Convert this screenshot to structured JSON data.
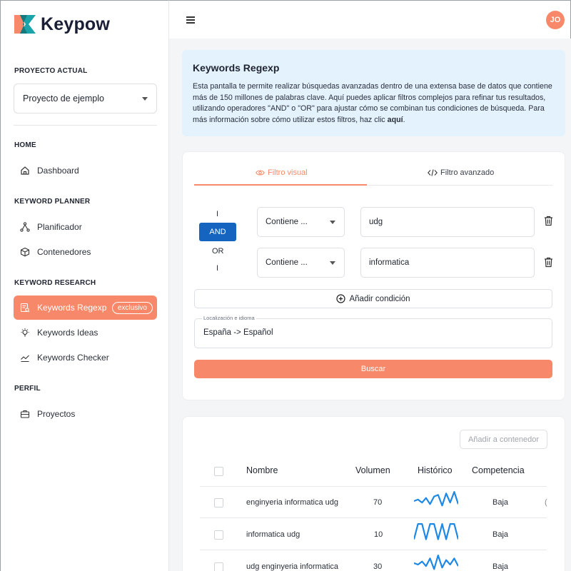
{
  "brand": {
    "name": "Keypow",
    "accent": "#f7896a",
    "accent_dark": "#14a0a6"
  },
  "sidebar": {
    "project_label": "PROYECTO ACTUAL",
    "project_value": "Proyecto de ejemplo",
    "sections": {
      "home": "HOME",
      "planner": "KEYWORD PLANNER",
      "research": "KEYWORD RESEARCH",
      "profile": "PERFIL"
    },
    "items": {
      "dashboard": {
        "label": "Dashboard",
        "icon": "home-icon"
      },
      "planificador": {
        "label": "Planificador",
        "icon": "branch-icon"
      },
      "contenedores": {
        "label": "Contenedores",
        "icon": "box-icon"
      },
      "regexp": {
        "label": "Keywords Regexp",
        "icon": "regexp-icon",
        "badge": "exclusivo"
      },
      "ideas": {
        "label": "Keywords Ideas",
        "icon": "bulb-icon"
      },
      "checker": {
        "label": "Keywords Checker",
        "icon": "chart-icon"
      },
      "proyectos": {
        "label": "Proyectos",
        "icon": "briefcase-icon"
      }
    }
  },
  "topbar": {
    "avatar_initials": "JO"
  },
  "info": {
    "title": "Keywords Regexp",
    "text": "Esta pantalla te permite realizar búsquedas avanzadas dentro de una extensa base de datos que contiene más de 150 millones de palabras clave. Aquí puedes aplicar filtros complejos para refinar tus resultados, utilizando operadores \"AND\" o \"OR\" para ajustar cómo se combinan tus condiciones de búsqueda. Para más información sobre cómo utilizar estos filtros, haz clic ",
    "link": "aquí",
    "end": "."
  },
  "filter": {
    "tab_visual": "Filtro visual",
    "tab_advanced": "Filtro avanzado",
    "op_and": "AND",
    "op_or": "OR",
    "bar": "I",
    "conditions": [
      {
        "operator": "Contiene ...",
        "value": "udg"
      },
      {
        "operator": "Contiene ...",
        "value": "informatica"
      }
    ],
    "add_condition": "Añadir condición",
    "location_label": "Localización e idioma",
    "location_value": "España -> Español",
    "search_button": "Buscar"
  },
  "results": {
    "add_to_container": "Añadir a contenedor",
    "columns": {
      "name": "Nombre",
      "volume": "Volumen",
      "history": "Histórico",
      "competition": "Competencia"
    },
    "rows": [
      {
        "name": "enginyeria informatica udg",
        "volume": "70",
        "history": [
          14,
          16,
          12,
          18,
          10,
          20,
          22,
          8,
          24,
          12,
          26,
          10
        ],
        "competition": "Baja"
      },
      {
        "name": "informatica udg",
        "volume": "10",
        "history": [
          6,
          26,
          26,
          6,
          26,
          26,
          6,
          26,
          6,
          26,
          26,
          6
        ],
        "competition": "Baja"
      },
      {
        "name": "udg enginyeria informatica",
        "volume": "30",
        "history": [
          16,
          14,
          18,
          12,
          22,
          8,
          26,
          10,
          20,
          14,
          22,
          12
        ],
        "competition": "Baja"
      }
    ]
  }
}
